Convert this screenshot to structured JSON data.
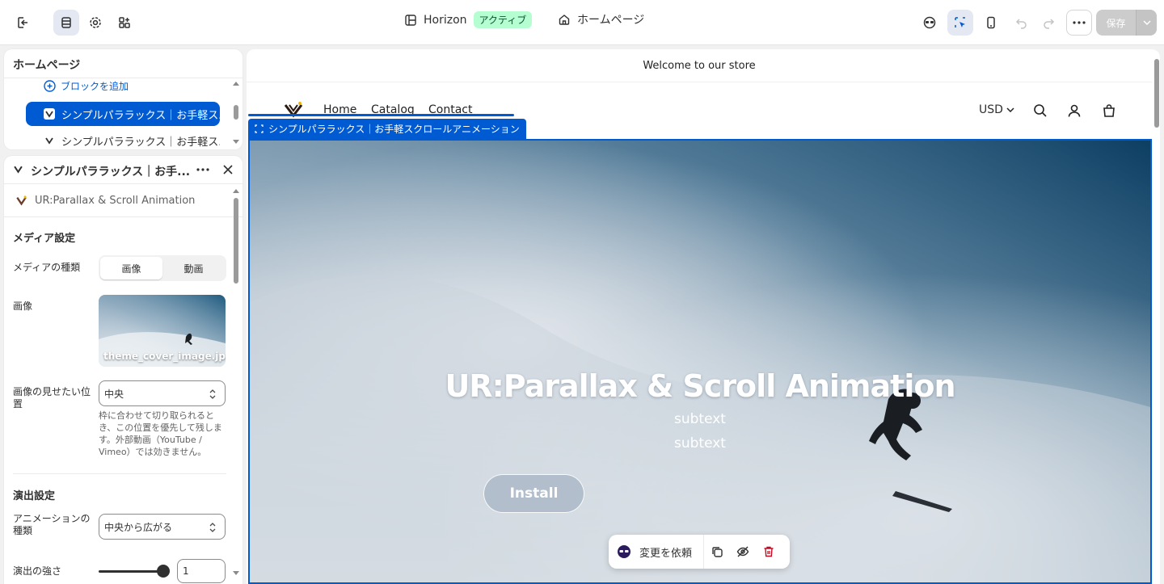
{
  "topbar": {
    "theme_name": "Horizon",
    "theme_status": "アクティブ",
    "page_name": "ホームページ",
    "save_label": "保存"
  },
  "tree": {
    "title": "ホームページ",
    "add_block": "ブロックを追加",
    "items": [
      {
        "label": "シンプルパララックス｜お手軽ス..."
      },
      {
        "label": "シンプルパララックス｜お手軽ス..."
      }
    ]
  },
  "settings": {
    "header_title": "シンプルパララックス｜お手...",
    "app_name": "UR:Parallax & Scroll Animation",
    "media_section": "メディア設定",
    "media_type_label": "メディアの種類",
    "media_type_options": [
      "画像",
      "動画"
    ],
    "media_type_selected": "画像",
    "image_label": "画像",
    "image_filename": "theme_cover_image.jpg",
    "focal_label": "画像の見せたい位置",
    "focal_value": "中央",
    "focal_help": "枠に合わせて切り取られるとき、この位置を優先して残します。外部動画（YouTube / Vimeo）では効きません。",
    "effect_section": "演出設定",
    "anim_label": "アニメーションの種類",
    "anim_value": "中央から広がる",
    "strength_label": "演出の強さ",
    "strength_value": "1"
  },
  "preview": {
    "announcement": "Welcome to our store",
    "nav": [
      "Home",
      "Catalog",
      "Contact"
    ],
    "currency": "USD",
    "selection_label": "シンプルパララックス｜お手軽スクロールアニメーション",
    "hero_title": "UR:Parallax & Scroll Animation",
    "hero_subtext_1": "subtext",
    "hero_subtext_2": "subtext",
    "hero_button": "Install",
    "float_ask": "変更を依頼"
  },
  "colors": {
    "accent": "#005bd3",
    "badge_bg": "#b4fed2",
    "delete": "#c70a24"
  },
  "icons": [
    "exit-icon",
    "sections-icon",
    "gear-icon",
    "apps-icon",
    "layout-icon",
    "home-icon",
    "inspector-icon",
    "select-icon",
    "mobile-icon",
    "undo-icon",
    "redo-icon",
    "more-icon",
    "chevron-down-icon",
    "plus-circle-icon",
    "close-icon",
    "search-icon",
    "account-icon",
    "cart-icon",
    "duplicate-icon",
    "hide-icon",
    "trash-icon"
  ]
}
